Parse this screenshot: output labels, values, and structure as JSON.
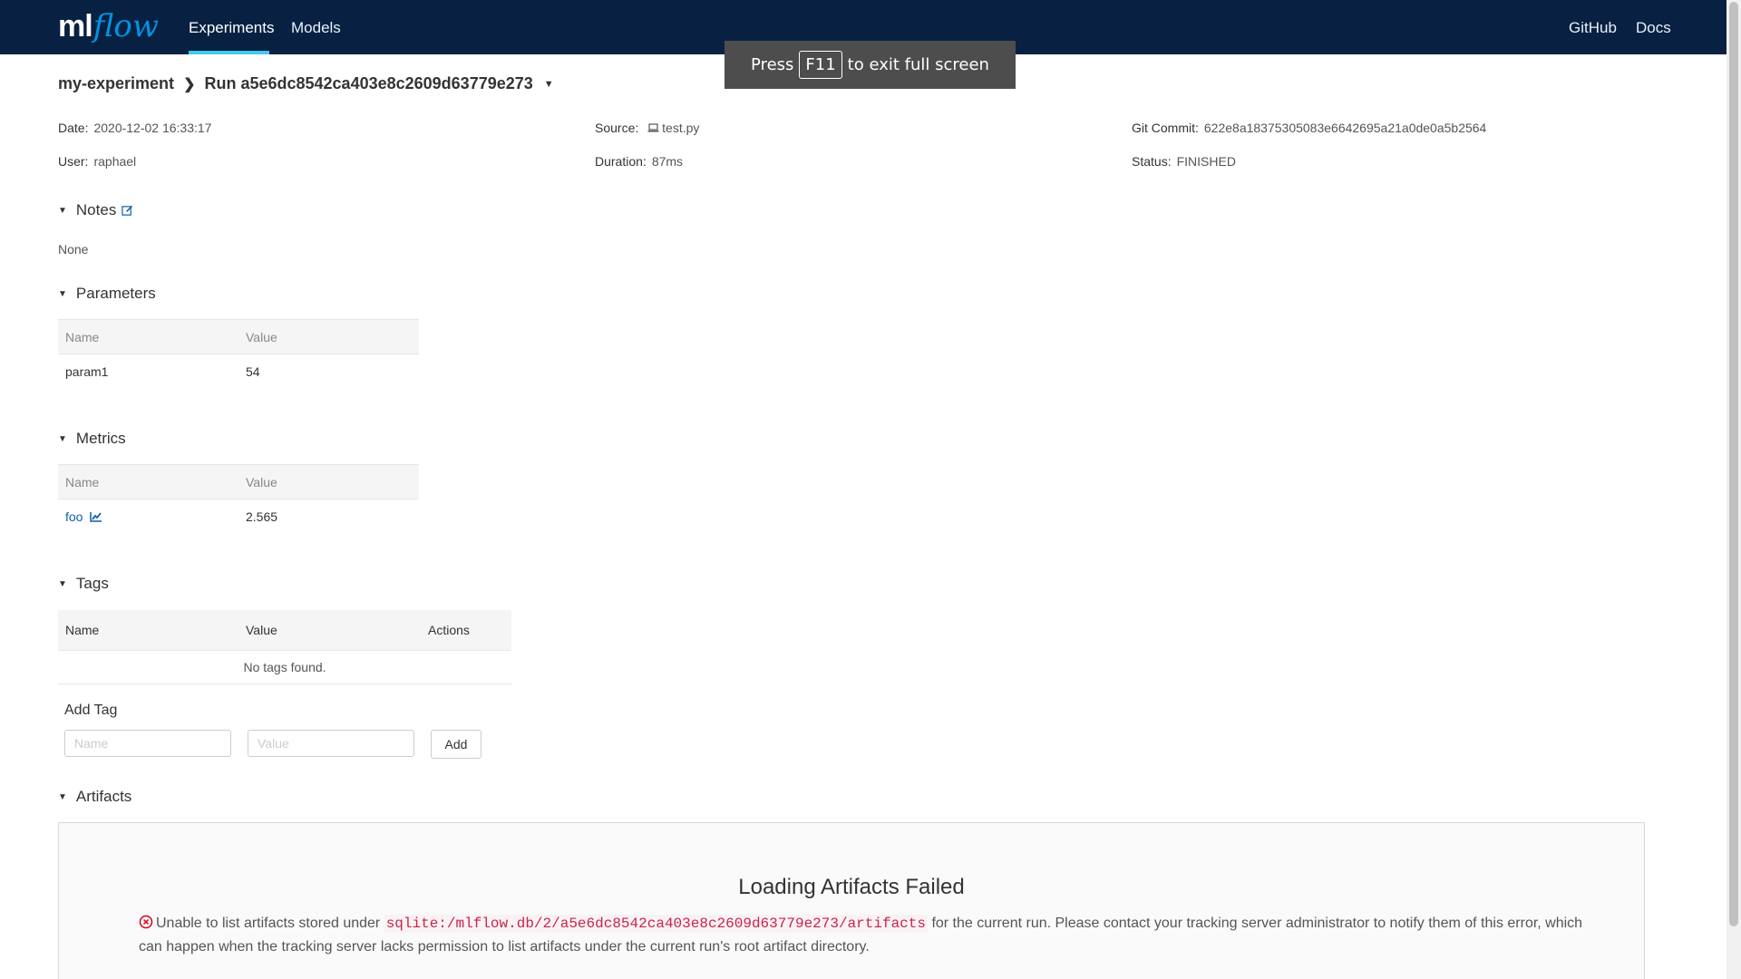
{
  "nav": {
    "logo_ml": "ml",
    "logo_flow": "flow",
    "experiments": "Experiments",
    "models": "Models",
    "github": "GitHub",
    "docs": "Docs"
  },
  "fullscreen_toast": {
    "before": "Press",
    "key": "F11",
    "after": "to exit full screen"
  },
  "breadcrumb": {
    "experiment": "my-experiment",
    "run": "Run a5e6dc8542ca403e8c2609d63779e273"
  },
  "meta": {
    "date_label": "Date:",
    "date": "2020-12-02 16:33:17",
    "user_label": "User:",
    "user": "raphael",
    "source_label": "Source:",
    "source": "test.py",
    "duration_label": "Duration:",
    "duration": "87ms",
    "git_label": "Git Commit:",
    "git": "622e8a18375305083e6642695a21a0de0a5b2564",
    "status_label": "Status:",
    "status": "FINISHED"
  },
  "notes": {
    "title": "Notes",
    "content": "None"
  },
  "parameters": {
    "title": "Parameters",
    "col_name": "Name",
    "col_value": "Value",
    "rows": [
      {
        "name": "param1",
        "value": "54"
      }
    ]
  },
  "metrics": {
    "title": "Metrics",
    "col_name": "Name",
    "col_value": "Value",
    "rows": [
      {
        "name": "foo",
        "value": "2.565"
      }
    ]
  },
  "tags": {
    "title": "Tags",
    "col_name": "Name",
    "col_value": "Value",
    "col_actions": "Actions",
    "empty": "No tags found.",
    "add_label": "Add Tag",
    "name_placeholder": "Name",
    "value_placeholder": "Value",
    "add_button": "Add"
  },
  "artifacts": {
    "title": "Artifacts",
    "error_title": "Loading Artifacts Failed",
    "msg_before": "Unable to list artifacts stored under",
    "path": "sqlite:/mlflow.db/2/a5e6dc8542ca403e8c2609d63779e273/artifacts",
    "msg_after": "for the current run. Please contact your tracking server administrator to notify them of this error, which can happen when the tracking server lacks permission to list artifacts under the current run's root artifact directory."
  },
  "colors": {
    "nav_bg": "#082142",
    "accent": "#43c9ed",
    "link": "#0f5fa8",
    "error": "#d0021b"
  }
}
